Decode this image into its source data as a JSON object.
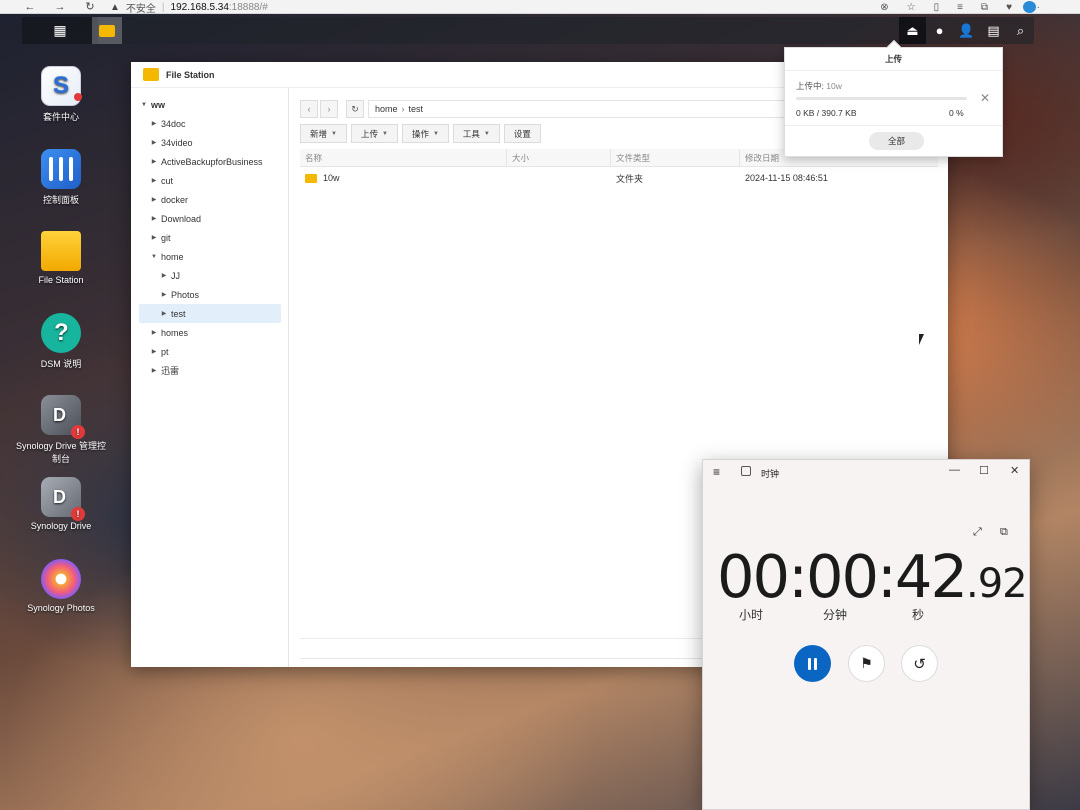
{
  "browser": {
    "security_warning": "不安全",
    "url_host": "192.168.5.34",
    "url_rest": ":18888/#"
  },
  "desktop_icons": [
    {
      "label": "套件中心",
      "icon": "package-center-icon"
    },
    {
      "label": "控制面板",
      "icon": "control-panel-icon"
    },
    {
      "label": "File Station",
      "icon": "file-station-icon"
    },
    {
      "label": "DSM 说明",
      "icon": "help-icon"
    },
    {
      "label": "Synology Drive 管理控制台",
      "icon": "synology-drive-admin-icon"
    },
    {
      "label": "Synology Drive",
      "icon": "synology-drive-icon"
    },
    {
      "label": "Synology Photos",
      "icon": "synology-photos-icon"
    }
  ],
  "file_station": {
    "title": "File Station",
    "tree": [
      {
        "label": "ww",
        "level": 0,
        "expanded": true
      },
      {
        "label": "34doc",
        "level": 1
      },
      {
        "label": "34video",
        "level": 1
      },
      {
        "label": "ActiveBackupforBusiness",
        "level": 1
      },
      {
        "label": "cut",
        "level": 1
      },
      {
        "label": "docker",
        "level": 1
      },
      {
        "label": "Download",
        "level": 1
      },
      {
        "label": "git",
        "level": 1
      },
      {
        "label": "home",
        "level": 1,
        "expanded": true
      },
      {
        "label": "JJ",
        "level": 2
      },
      {
        "label": "Photos",
        "level": 2
      },
      {
        "label": "test",
        "level": 2,
        "selected": true
      },
      {
        "label": "homes",
        "level": 1
      },
      {
        "label": "pt",
        "level": 1
      },
      {
        "label": "迅雷",
        "level": 1
      }
    ],
    "breadcrumb": {
      "root": "home",
      "current": "test"
    },
    "toolbar": {
      "new": "新增",
      "upload": "上传",
      "action": "操作",
      "tools": "工具",
      "settings": "设置"
    },
    "columns": {
      "name": "名称",
      "size": "大小",
      "type": "文件类型",
      "modified": "修改日期"
    },
    "rows": [
      {
        "name": "10w",
        "size": "",
        "type": "文件夹",
        "modified": "2024-11-15 08:46:51"
      }
    ]
  },
  "upload_popup": {
    "title": "上传",
    "status_label": "上传中:",
    "file_name": "10w",
    "size_progress": "0 KB / 390.7 KB",
    "percent": "0 %",
    "progress_fraction": 0,
    "all_button": "全部"
  },
  "clock_app": {
    "title": "时钟",
    "time_main": "00:00:42",
    "time_cs": ".92",
    "label_hours": "小时",
    "label_minutes": "分钟",
    "label_seconds": "秒"
  },
  "colors": {
    "accent": "#0a66c2",
    "folder": "#f5b800",
    "selection": "#e2eefa"
  }
}
